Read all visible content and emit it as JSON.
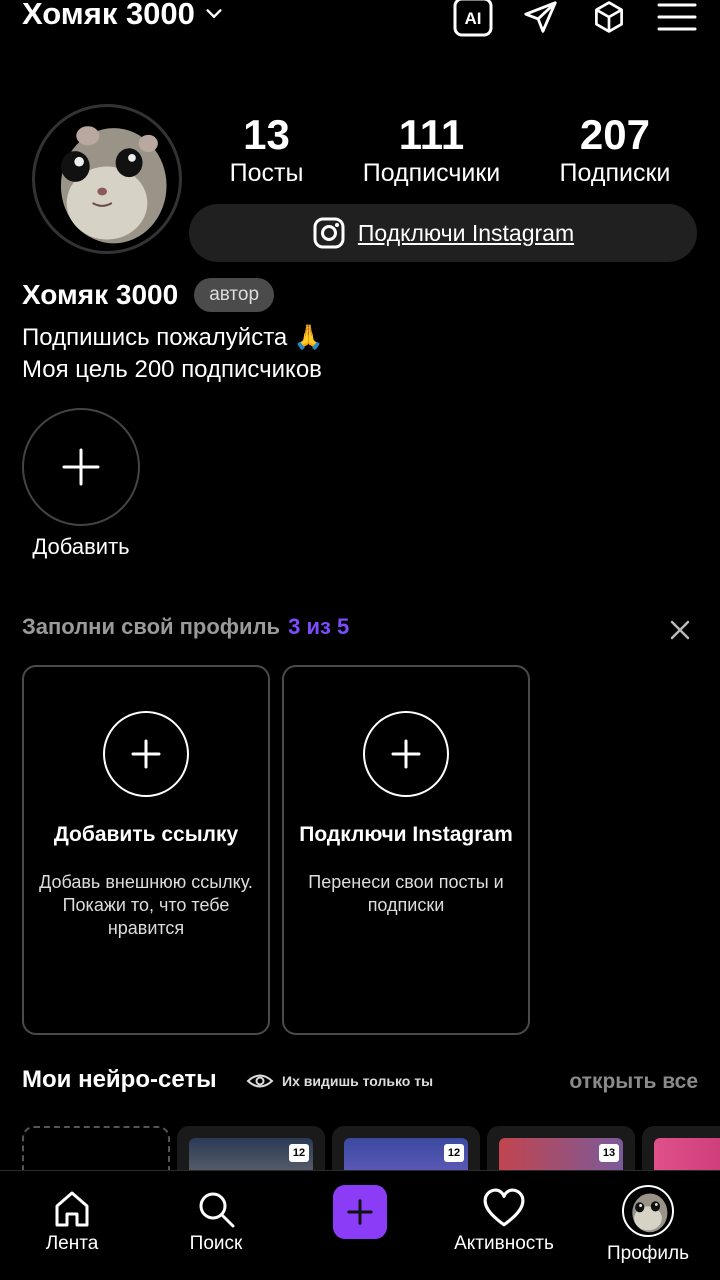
{
  "header": {
    "username": "Хомяк 3000",
    "icons": [
      "ai-icon",
      "send-icon",
      "cube-icon",
      "menu-icon"
    ],
    "ai_label": "AI"
  },
  "stats": [
    {
      "value": "13",
      "label": "Посты"
    },
    {
      "value": "111",
      "label": "Подписчики"
    },
    {
      "value": "207",
      "label": "Подписки"
    }
  ],
  "instagram_button": {
    "label": "Подключи Instagram"
  },
  "profile": {
    "name": "Хомяк 3000",
    "badge": "автор",
    "bio_line1": "Подпишись пожалуйста 🙏",
    "bio_line2": "Моя цель 200 подписчиков"
  },
  "stories": {
    "add_label": "Добавить"
  },
  "fill_profile": {
    "title": "Заполни свой профиль",
    "progress": "3 из 5",
    "cards": [
      {
        "title": "Добавить ссылку",
        "description": "Добавь внешнюю ссылку. Покажи то, что тебе нравится"
      },
      {
        "title": "Подключи Instagram",
        "description": "Перенеси свои посты и подписки"
      }
    ]
  },
  "neuro": {
    "title": "Мои нейро-сеты",
    "visibility": "Их видишь только ты",
    "open_all": "открыть все",
    "thumb_counts": [
      "12",
      "12",
      "13"
    ]
  },
  "nav": {
    "items": [
      {
        "label": "Лента"
      },
      {
        "label": "Поиск"
      },
      {
        "label": ""
      },
      {
        "label": "Активность"
      },
      {
        "label": "Профиль"
      }
    ]
  },
  "colors": {
    "accent": "#7c4dff",
    "plus_button": "#8b3cf7",
    "background": "#000000"
  }
}
